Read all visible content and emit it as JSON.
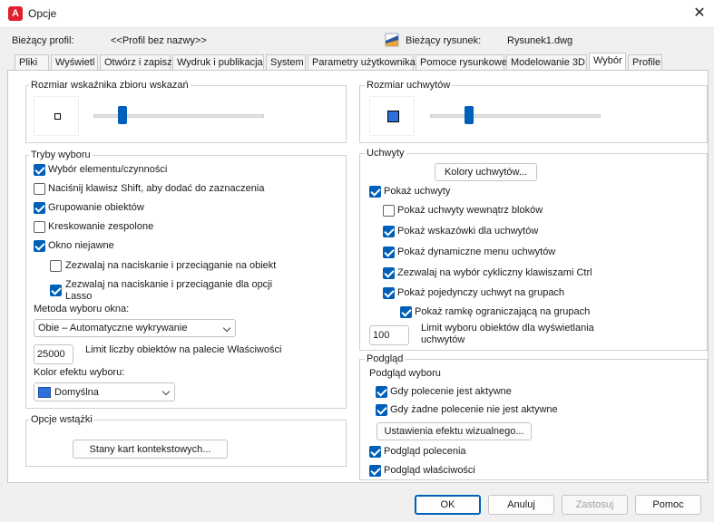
{
  "window": {
    "title": "Opcje",
    "app_icon_letter": "A"
  },
  "profile": {
    "label": "Bieżący profil:",
    "value": "<<Profil bez nazwy>>"
  },
  "drawing": {
    "label": "Bieżący rysunek:",
    "value": "Rysunek1.dwg"
  },
  "tabs": [
    {
      "label": "Pliki"
    },
    {
      "label": "Wyświetl"
    },
    {
      "label": "Otwórz i zapisz"
    },
    {
      "label": "Wydruk i publikacja"
    },
    {
      "label": "System"
    },
    {
      "label": "Parametry użytkownika"
    },
    {
      "label": "Pomoce rysunkowe"
    },
    {
      "label": "Modelowanie 3D"
    },
    {
      "label": "Wybór"
    },
    {
      "label": "Profile"
    }
  ],
  "pickbox": {
    "title": "Rozmiar wskaźnika zbioru wskazań",
    "level": 0.17
  },
  "gripsize": {
    "title": "Rozmiar uchwytów",
    "level": 0.23
  },
  "selection_modes": {
    "title": "Tryby wyboru",
    "items": [
      {
        "label": "Wybór elementu/czynności",
        "checked": true
      },
      {
        "label": "Naciśnij klawisz Shift, aby dodać do zaznaczenia",
        "checked": false
      },
      {
        "label": "Grupowanie obiektów",
        "checked": true
      },
      {
        "label": "Kreskowanie zespolone",
        "checked": false
      },
      {
        "label": "Okno niejawne",
        "checked": true
      },
      {
        "label": "Zezwalaj na naciskanie i przeciąganie na obiekt",
        "checked": false
      },
      {
        "label": "Zezwalaj na naciskanie i przeciąganie dla opcji",
        "label2": "Lasso",
        "checked": true
      }
    ],
    "window_method_label": "Metoda wyboru okna:",
    "window_method_value": "Obie – Automatyczne wykrywanie",
    "limit_value": "25000",
    "limit_label": "Limit liczby obiektów na palecie Właściwości",
    "color_label": "Kolor efektu wyboru:",
    "color_value": "Domyślna",
    "color_hex": "#2f6fd9"
  },
  "ribbon": {
    "title": "Opcje wstążki",
    "button": "Stany kart kontekstowych..."
  },
  "grips": {
    "title": "Uchwyty",
    "colors_button": "Kolory uchwytów...",
    "items": [
      {
        "label": "Pokaż uchwyty",
        "checked": true
      },
      {
        "label": "Pokaż uchwyty wewnątrz bloków",
        "checked": false
      },
      {
        "label": "Pokaż wskazówki dla uchwytów",
        "checked": true
      },
      {
        "label": "Pokaż dynamiczne menu uchwytów",
        "checked": true
      },
      {
        "label": "Zezwalaj na wybór cykliczny klawiszami Ctrl",
        "checked": true
      },
      {
        "label": "Pokaż pojedynczy uchwyt na grupach",
        "checked": true
      },
      {
        "label": "Pokaż ramkę ograniczającą na grupach",
        "checked": true
      }
    ],
    "limit_value": "100",
    "limit_label1": "Limit wyboru obiektów dla wyświetlania",
    "limit_label2": "uchwytów"
  },
  "preview": {
    "title": "Podgląd",
    "sub_title": "Podgląd wyboru",
    "items": [
      {
        "label": "Gdy polecenie jest aktywne",
        "checked": true
      },
      {
        "label": "Gdy żadne polecenie nie jest aktywne",
        "checked": true
      }
    ],
    "visual_button": "Ustawienia efektu wizualnego...",
    "items2": [
      {
        "label": "Podgląd polecenia",
        "checked": true
      },
      {
        "label": "Podgląd właściwości",
        "checked": true
      }
    ]
  },
  "buttons": {
    "ok": "OK",
    "cancel": "Anuluj",
    "apply": "Zastosuj",
    "help": "Pomoc"
  }
}
